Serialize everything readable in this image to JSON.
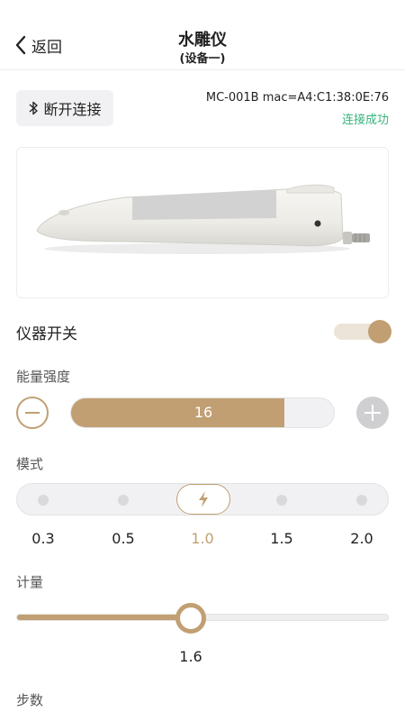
{
  "nav": {
    "back_label": "返回",
    "title": "水雕仪",
    "subtitle": "(设备一)"
  },
  "bluetooth": {
    "button_label": "断开连接",
    "device_id": "MC-001B mac=A4:C1:38:0E:76",
    "status": "连接成功",
    "status_color": "#37b37e"
  },
  "device": {
    "image": "handheld-device-pen"
  },
  "power": {
    "label": "仪器开关",
    "on": true
  },
  "energy": {
    "label": "能量强度",
    "value": "16",
    "fill_fraction": 0.81,
    "minus_icon": "minus-icon",
    "plus_icon": "plus-icon"
  },
  "mode": {
    "label": "模式",
    "options": [
      "0.3",
      "0.5",
      "1.0",
      "1.5",
      "2.0"
    ],
    "selected_index": 2,
    "selected_icon": "lightning-icon"
  },
  "meter": {
    "label": "计量",
    "value": "1.6",
    "fraction": 0.47
  },
  "steps": {
    "label": "步数"
  },
  "colors": {
    "accent": "#c19f73",
    "track": "#f1f1f4",
    "success": "#37b37e"
  }
}
